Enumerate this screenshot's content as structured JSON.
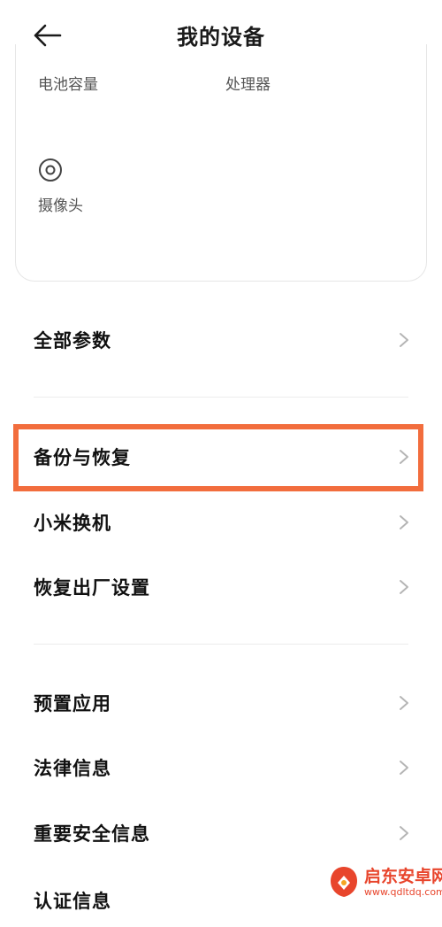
{
  "header": {
    "title": "我的设备"
  },
  "card": {
    "specs": [
      "电池容量",
      "处理器",
      "摄像头"
    ]
  },
  "menu": {
    "group1": [
      "全部参数"
    ],
    "group2": [
      "备份与恢复",
      "小米换机",
      "恢复出厂设置"
    ],
    "group3": [
      "预置应用",
      "法律信息",
      "重要安全信息",
      "认证信息"
    ]
  },
  "highlight": {
    "color": "#f26d3d",
    "target": "备份与恢复"
  },
  "watermark": {
    "title": "启东安卓网",
    "url": "www.qdltdq.com"
  }
}
